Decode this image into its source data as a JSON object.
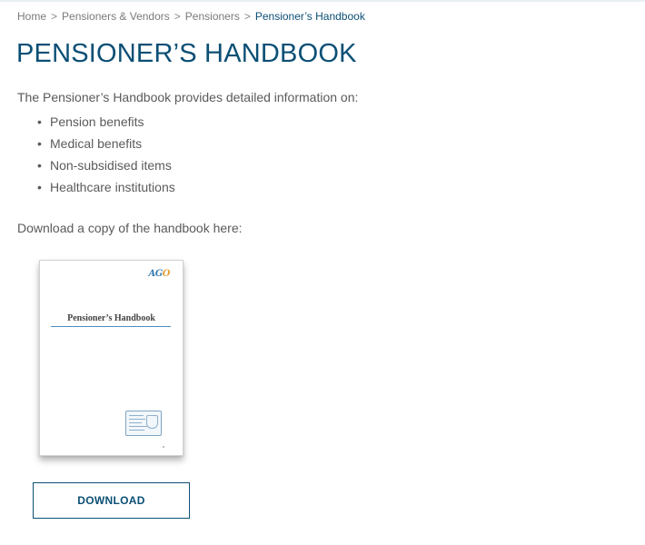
{
  "breadcrumb": {
    "items": [
      {
        "label": "Home"
      },
      {
        "label": "Pensioners & Vendors"
      },
      {
        "label": "Pensioners"
      },
      {
        "label": "Pensioner’s Handbook"
      }
    ],
    "separator": ">"
  },
  "page": {
    "title": "PENSIONER’S HANDBOOK",
    "intro": "The Pensioner’s Handbook provides detailed information on:",
    "topics": [
      "Pension benefits",
      "Medical benefits",
      "Non-subsidised items",
      "Healthcare institutions"
    ],
    "bullet": "•",
    "download_text": "Download a copy of the handbook here:"
  },
  "handbook_cover": {
    "logo": "AGO",
    "title": "Pensioner’s Handbook"
  },
  "download_button": {
    "label": "DOWNLOAD"
  },
  "colors": {
    "primary": "#0b4f75",
    "body_text": "#5a5a5a",
    "breadcrumb_text": "#7a7a7a"
  }
}
